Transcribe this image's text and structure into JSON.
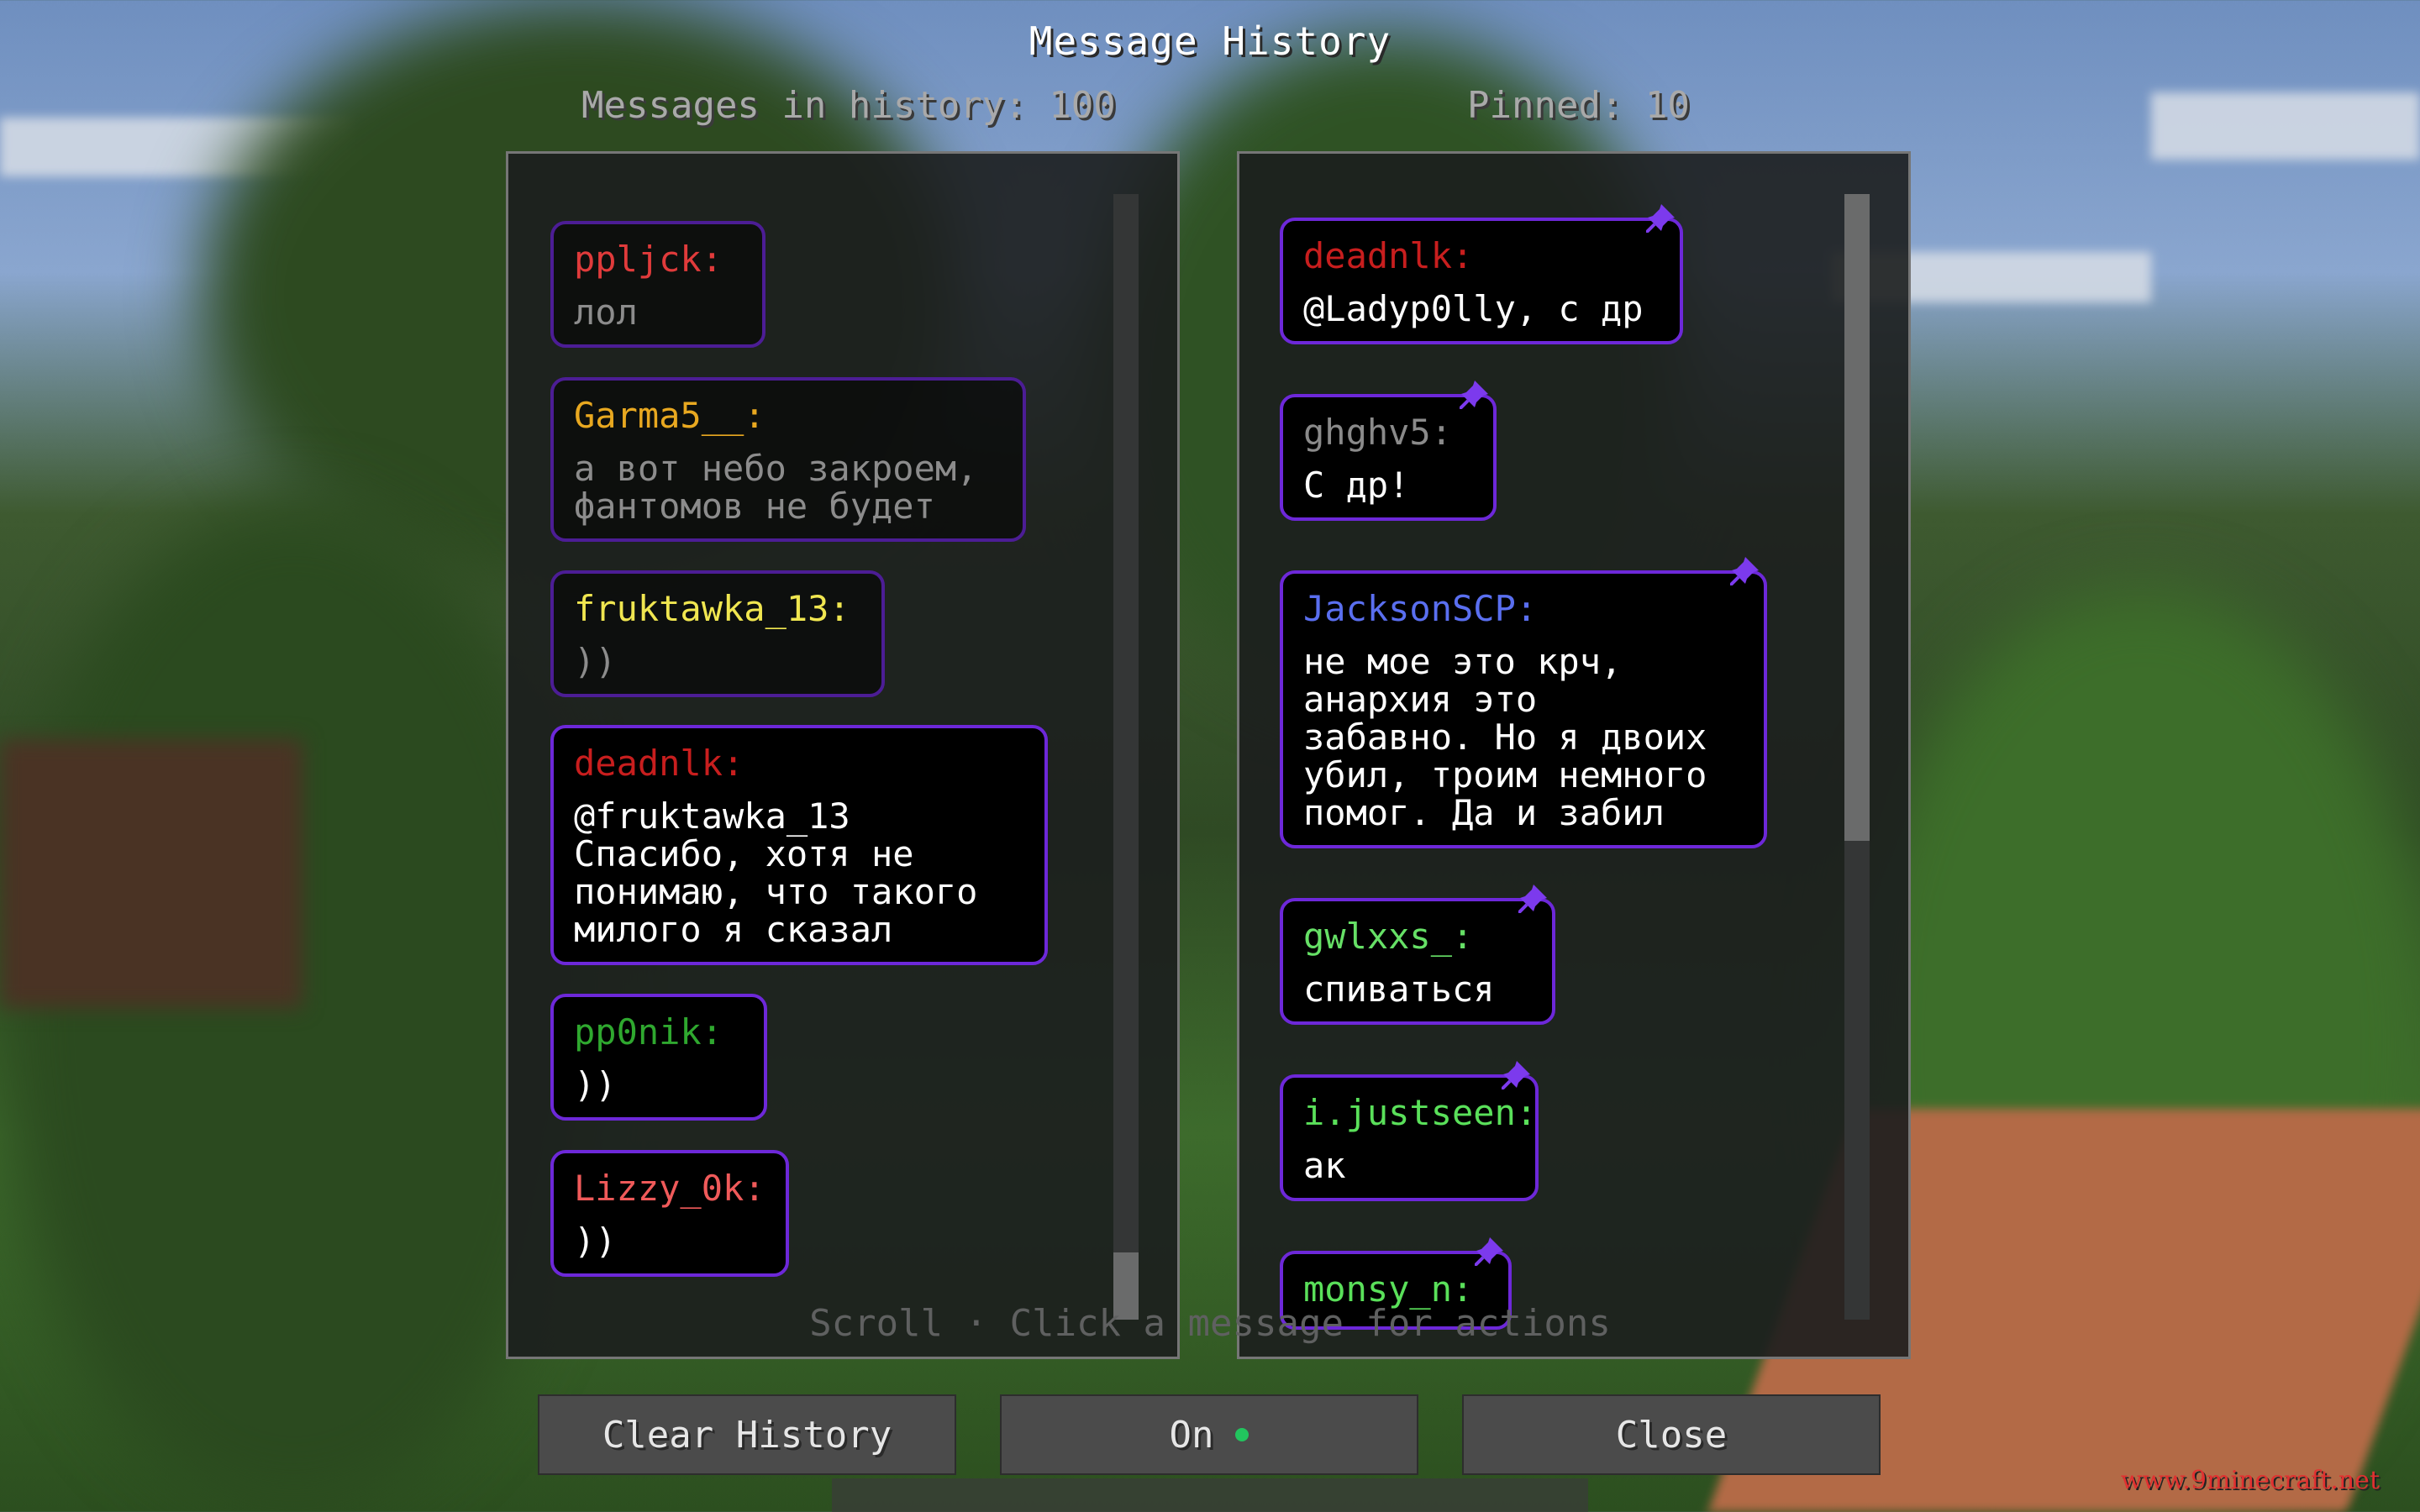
{
  "title": "Message History",
  "counts": {
    "history": "Messages in history: 100",
    "pinned": "Pinned: 10"
  },
  "history": [
    {
      "author": "ppljck:",
      "text": "лол",
      "color": "#e03b3b",
      "style": "dim"
    },
    {
      "author": "Garma5__:",
      "text": "а вот небо закроем,\nфантомов не будет",
      "color": "#e8a820",
      "style": "dim"
    },
    {
      "author": "fruktawka_13:",
      "text": "))",
      "color": "#f0e650",
      "style": "dim"
    },
    {
      "author": "deadnlk:",
      "text": "@fruktawka_13\nСпасибо, хотя не\nпонимаю, что такого\nмилого я сказал",
      "color": "#c81e1e",
      "style": "bright"
    },
    {
      "author": "pp0nik:",
      "text": "))",
      "color": "#2fa82f",
      "style": "bright"
    },
    {
      "author": "Lizzy_0k:",
      "text": "))",
      "color": "#f05a5a",
      "style": "bright"
    }
  ],
  "pinned": [
    {
      "author": "deadnlk:",
      "text": "@Ladyp0lly, с др",
      "color": "#c81e1e"
    },
    {
      "author": "ghghv5:",
      "text": "С др!",
      "color": "#8a8a8a"
    },
    {
      "author": "JacksonSCP:",
      "text": "не мое это крч,\nанархия это\nзабавно. Но я двоих\nубил, троим немного\nпомог. Да и забил",
      "color": "#5a6ff0"
    },
    {
      "author": "gwlxxs_:",
      "text": "спиваться",
      "color": "#66e066"
    },
    {
      "author": "i.justseen:",
      "text": "ак",
      "color": "#5ae05a"
    },
    {
      "author": "monsy_n:",
      "text": "",
      "color": "#5ae05a"
    }
  ],
  "hint": "Scroll · Click a message for actions",
  "buttons": {
    "clear": "Clear History",
    "toggle": "On",
    "close": "Close"
  },
  "watermark": "www.9minecraft.net",
  "colors": {
    "border": "#6d28d9",
    "toggle_dot": "#22c55e"
  }
}
